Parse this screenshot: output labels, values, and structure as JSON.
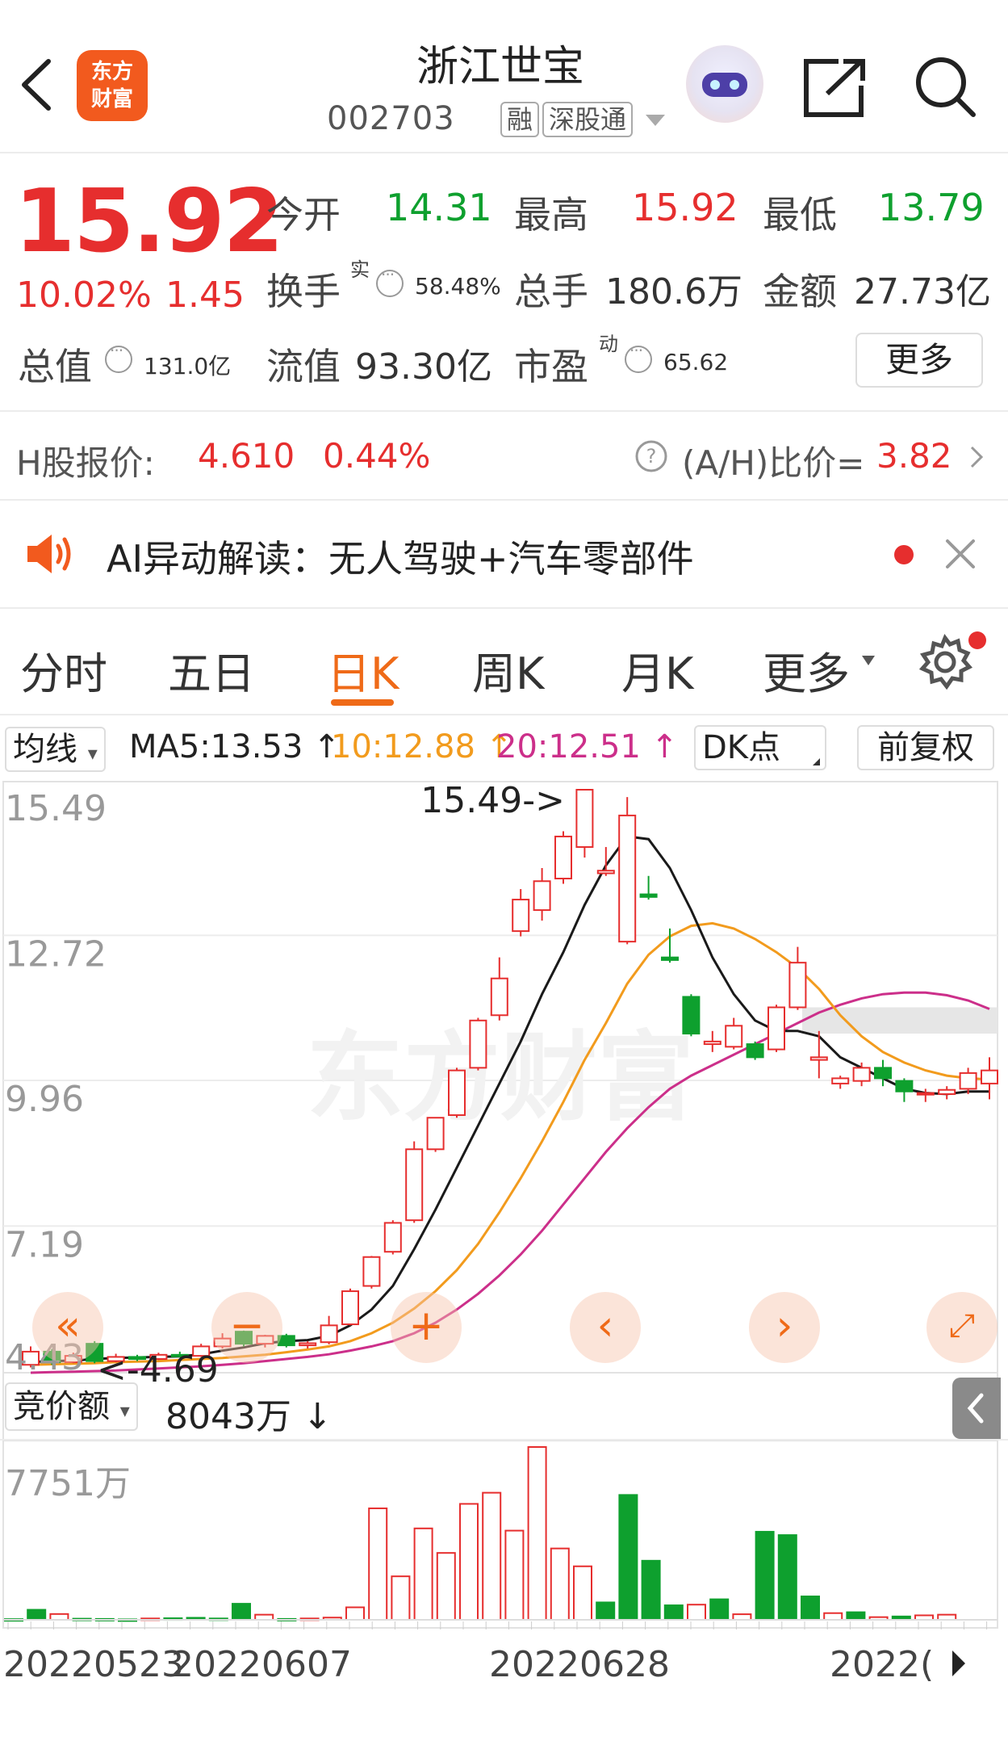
{
  "header": {
    "logo_text_line1": "东方",
    "logo_text_line2": "财富",
    "title": "浙江世宝",
    "code": "002703",
    "tags": [
      "融",
      "深股通"
    ]
  },
  "quote": {
    "price": "15.92",
    "change_pct": "10.02%",
    "change": "1.45",
    "open_label": "今开",
    "open": "14.31",
    "high_label": "最高",
    "high": "15.92",
    "low_label": "最低",
    "low": "13.79",
    "turnover_label": "换手",
    "turnover_sup": "实",
    "turnover": "58.48%",
    "volume_label": "总手",
    "volume": "180.6万",
    "amount_label": "金额",
    "amount": "27.73亿",
    "mktcap_label": "总值",
    "mktcap": "131.0亿",
    "float_label": "流值",
    "float_cap": "93.30亿",
    "pe_label": "市盈",
    "pe_sup": "动",
    "pe": "65.62",
    "more_label": "更多"
  },
  "hshare": {
    "label": "H股报价:",
    "price": "4.610",
    "pct": "0.44%",
    "ratio_label": "(A/H)比价=",
    "ratio": "3.82"
  },
  "ai": {
    "text": "AI异动解读：无人驾驶+汽车零部件"
  },
  "tabs": [
    {
      "label": "分时"
    },
    {
      "label": "五日"
    },
    {
      "label": "日K"
    },
    {
      "label": "周K"
    },
    {
      "label": "月K"
    },
    {
      "label": "更多"
    }
  ],
  "ma_row": {
    "select": "均线",
    "ma5": "MA5:13.53 ↑",
    "ma10": "10:12.88 ↑",
    "ma20": "20:12.51 ↑",
    "dk": "DK点",
    "adjust": "前复权"
  },
  "colors": {
    "up": "#e62e2e",
    "down": "#0ea02e",
    "ma5": "#1a1a1a",
    "ma10": "#f29b1d",
    "ma20": "#cc2f8a",
    "accent": "#ef6a18"
  },
  "chart_data": {
    "type": "candlestick",
    "yticks": [
      "15.49",
      "12.72",
      "9.96",
      "7.19",
      "4.43"
    ],
    "ylim": [
      4.43,
      15.49
    ],
    "max_annotation": "15.49->",
    "min_annotation": "<-4.69",
    "watermark": "东方财富",
    "xticks": [
      "20220523",
      "20220607",
      "20220628",
      "2022("
    ],
    "candles": [
      {
        "o": 4.55,
        "c": 4.8,
        "h": 4.9,
        "l": 4.5
      },
      {
        "o": 4.8,
        "c": 4.6,
        "h": 4.85,
        "l": 4.55
      },
      {
        "o": 4.6,
        "c": 4.72,
        "h": 4.78,
        "l": 4.58
      },
      {
        "o": 4.95,
        "c": 4.62,
        "h": 5.0,
        "l": 4.58
      },
      {
        "o": 4.62,
        "c": 4.7,
        "h": 4.76,
        "l": 4.6
      },
      {
        "o": 4.7,
        "c": 4.66,
        "h": 4.74,
        "l": 4.62
      },
      {
        "o": 4.66,
        "c": 4.74,
        "h": 4.78,
        "l": 4.64
      },
      {
        "o": 4.74,
        "c": 4.72,
        "h": 4.8,
        "l": 4.69
      },
      {
        "o": 4.72,
        "c": 4.9,
        "h": 4.95,
        "l": 4.7
      },
      {
        "o": 4.9,
        "c": 5.05,
        "h": 5.15,
        "l": 4.86
      },
      {
        "o": 5.18,
        "c": 4.95,
        "h": 5.2,
        "l": 4.9
      },
      {
        "o": 4.95,
        "c": 5.1,
        "h": 5.12,
        "l": 4.88
      },
      {
        "o": 5.1,
        "c": 4.92,
        "h": 5.14,
        "l": 4.88
      },
      {
        "o": 4.92,
        "c": 4.96,
        "h": 5.0,
        "l": 4.86
      },
      {
        "o": 4.98,
        "c": 5.3,
        "h": 5.48,
        "l": 4.94
      },
      {
        "o": 5.32,
        "c": 5.95,
        "h": 6.0,
        "l": 5.3
      },
      {
        "o": 6.05,
        "c": 6.6,
        "h": 6.62,
        "l": 6.0
      },
      {
        "o": 6.7,
        "c": 7.25,
        "h": 7.3,
        "l": 6.65
      },
      {
        "o": 7.3,
        "c": 8.65,
        "h": 8.8,
        "l": 7.25
      },
      {
        "o": 8.65,
        "c": 9.25,
        "h": 9.25,
        "l": 8.6
      },
      {
        "o": 9.3,
        "c": 10.15,
        "h": 10.2,
        "l": 9.25
      },
      {
        "o": 10.2,
        "c": 11.1,
        "h": 11.15,
        "l": 10.15
      },
      {
        "o": 11.2,
        "c": 11.9,
        "h": 12.3,
        "l": 11.1
      },
      {
        "o": 12.8,
        "c": 13.4,
        "h": 13.6,
        "l": 12.7
      },
      {
        "o": 13.2,
        "c": 13.75,
        "h": 14.0,
        "l": 13.0
      },
      {
        "o": 13.8,
        "c": 14.6,
        "h": 14.7,
        "l": 13.7
      },
      {
        "o": 14.4,
        "c": 15.49,
        "h": 15.49,
        "l": 14.2
      },
      {
        "o": 13.9,
        "c": 13.95,
        "h": 14.4,
        "l": 13.85
      },
      {
        "o": 12.6,
        "c": 15.0,
        "h": 15.35,
        "l": 12.55
      },
      {
        "o": 13.5,
        "c": 13.45,
        "h": 13.85,
        "l": 13.4
      },
      {
        "o": 12.3,
        "c": 12.25,
        "h": 12.85,
        "l": 12.2
      },
      {
        "o": 11.55,
        "c": 10.85,
        "h": 11.6,
        "l": 10.8
      },
      {
        "o": 10.65,
        "c": 10.7,
        "h": 10.9,
        "l": 10.5
      },
      {
        "o": 10.6,
        "c": 11.0,
        "h": 11.15,
        "l": 10.55
      },
      {
        "o": 10.65,
        "c": 10.4,
        "h": 10.7,
        "l": 10.35
      },
      {
        "o": 10.55,
        "c": 11.35,
        "h": 11.4,
        "l": 10.5
      },
      {
        "o": 11.35,
        "c": 12.2,
        "h": 12.5,
        "l": 11.3
      },
      {
        "o": 10.35,
        "c": 10.4,
        "h": 10.9,
        "l": 10.0
      },
      {
        "o": 9.9,
        "c": 10.0,
        "h": 10.05,
        "l": 9.8
      },
      {
        "o": 9.95,
        "c": 10.2,
        "h": 10.3,
        "l": 9.85
      },
      {
        "o": 10.2,
        "c": 10.0,
        "h": 10.35,
        "l": 9.85
      },
      {
        "o": 9.95,
        "c": 9.75,
        "h": 10.0,
        "l": 9.55
      },
      {
        "o": 9.7,
        "c": 9.72,
        "h": 9.8,
        "l": 9.55
      },
      {
        "o": 9.7,
        "c": 9.78,
        "h": 9.85,
        "l": 9.6
      },
      {
        "o": 9.8,
        "c": 10.1,
        "h": 10.2,
        "l": 9.7
      },
      {
        "o": 9.9,
        "c": 10.15,
        "h": 10.4,
        "l": 9.6
      }
    ],
    "ma5": [
      4.6,
      4.62,
      4.63,
      4.66,
      4.68,
      4.69,
      4.7,
      4.71,
      4.75,
      4.82,
      4.88,
      4.96,
      5.0,
      5.02,
      5.1,
      5.3,
      5.6,
      6.05,
      6.75,
      7.5,
      8.3,
      9.1,
      9.9,
      10.7,
      11.6,
      12.4,
      13.3,
      14.05,
      14.6,
      14.55,
      14.0,
      13.2,
      12.3,
      11.6,
      11.1,
      10.9,
      10.9,
      10.8,
      10.4,
      10.2,
      10.0,
      9.8,
      9.72,
      9.7,
      9.75,
      9.75
    ],
    "ma10": [
      4.55,
      4.56,
      4.57,
      4.58,
      4.6,
      4.61,
      4.62,
      4.64,
      4.66,
      4.68,
      4.71,
      4.74,
      4.79,
      4.84,
      4.9,
      5.0,
      5.15,
      5.35,
      5.62,
      5.95,
      6.35,
      6.85,
      7.45,
      8.1,
      8.8,
      9.55,
      10.35,
      11.05,
      11.8,
      12.35,
      12.7,
      12.9,
      12.95,
      12.85,
      12.65,
      12.4,
      12.1,
      11.7,
      11.2,
      10.8,
      10.5,
      10.3,
      10.15,
      10.05,
      10.0,
      9.98
    ],
    "ma20": [
      4.4,
      4.41,
      4.42,
      4.43,
      4.44,
      4.46,
      4.48,
      4.5,
      4.52,
      4.55,
      4.58,
      4.62,
      4.66,
      4.7,
      4.75,
      4.82,
      4.9,
      5.0,
      5.15,
      5.35,
      5.6,
      5.9,
      6.25,
      6.65,
      7.1,
      7.6,
      8.1,
      8.6,
      9.05,
      9.45,
      9.8,
      10.05,
      10.25,
      10.45,
      10.65,
      10.85,
      11.05,
      11.25,
      11.4,
      11.52,
      11.6,
      11.63,
      11.63,
      11.58,
      11.48,
      11.32
    ],
    "volume": {
      "label": "竞价额",
      "value": "8043万 ↓",
      "max_label": "7751万",
      "max": 7751,
      "bars": [
        30,
        450,
        260,
        50,
        40,
        20,
        60,
        70,
        90,
        60,
        720,
        230,
        40,
        60,
        100,
        560,
        5000,
        1950,
        4100,
        3000,
        5200,
        5700,
        4000,
        7751,
        3200,
        2400,
        780,
        5600,
        2650,
        650,
        680,
        920,
        250,
        3950,
        3800,
        1050,
        300,
        340,
        120,
        150,
        200,
        230
      ]
    },
    "volume_up": [
      false,
      false,
      true,
      false,
      false,
      false,
      true,
      false,
      false,
      false,
      false,
      true,
      false,
      true,
      true,
      true,
      true,
      true,
      true,
      true,
      true,
      true,
      true,
      true,
      true,
      true,
      false,
      false,
      false,
      false,
      true,
      false,
      true,
      false,
      false,
      false,
      true,
      false,
      true,
      false,
      true,
      true
    ]
  }
}
